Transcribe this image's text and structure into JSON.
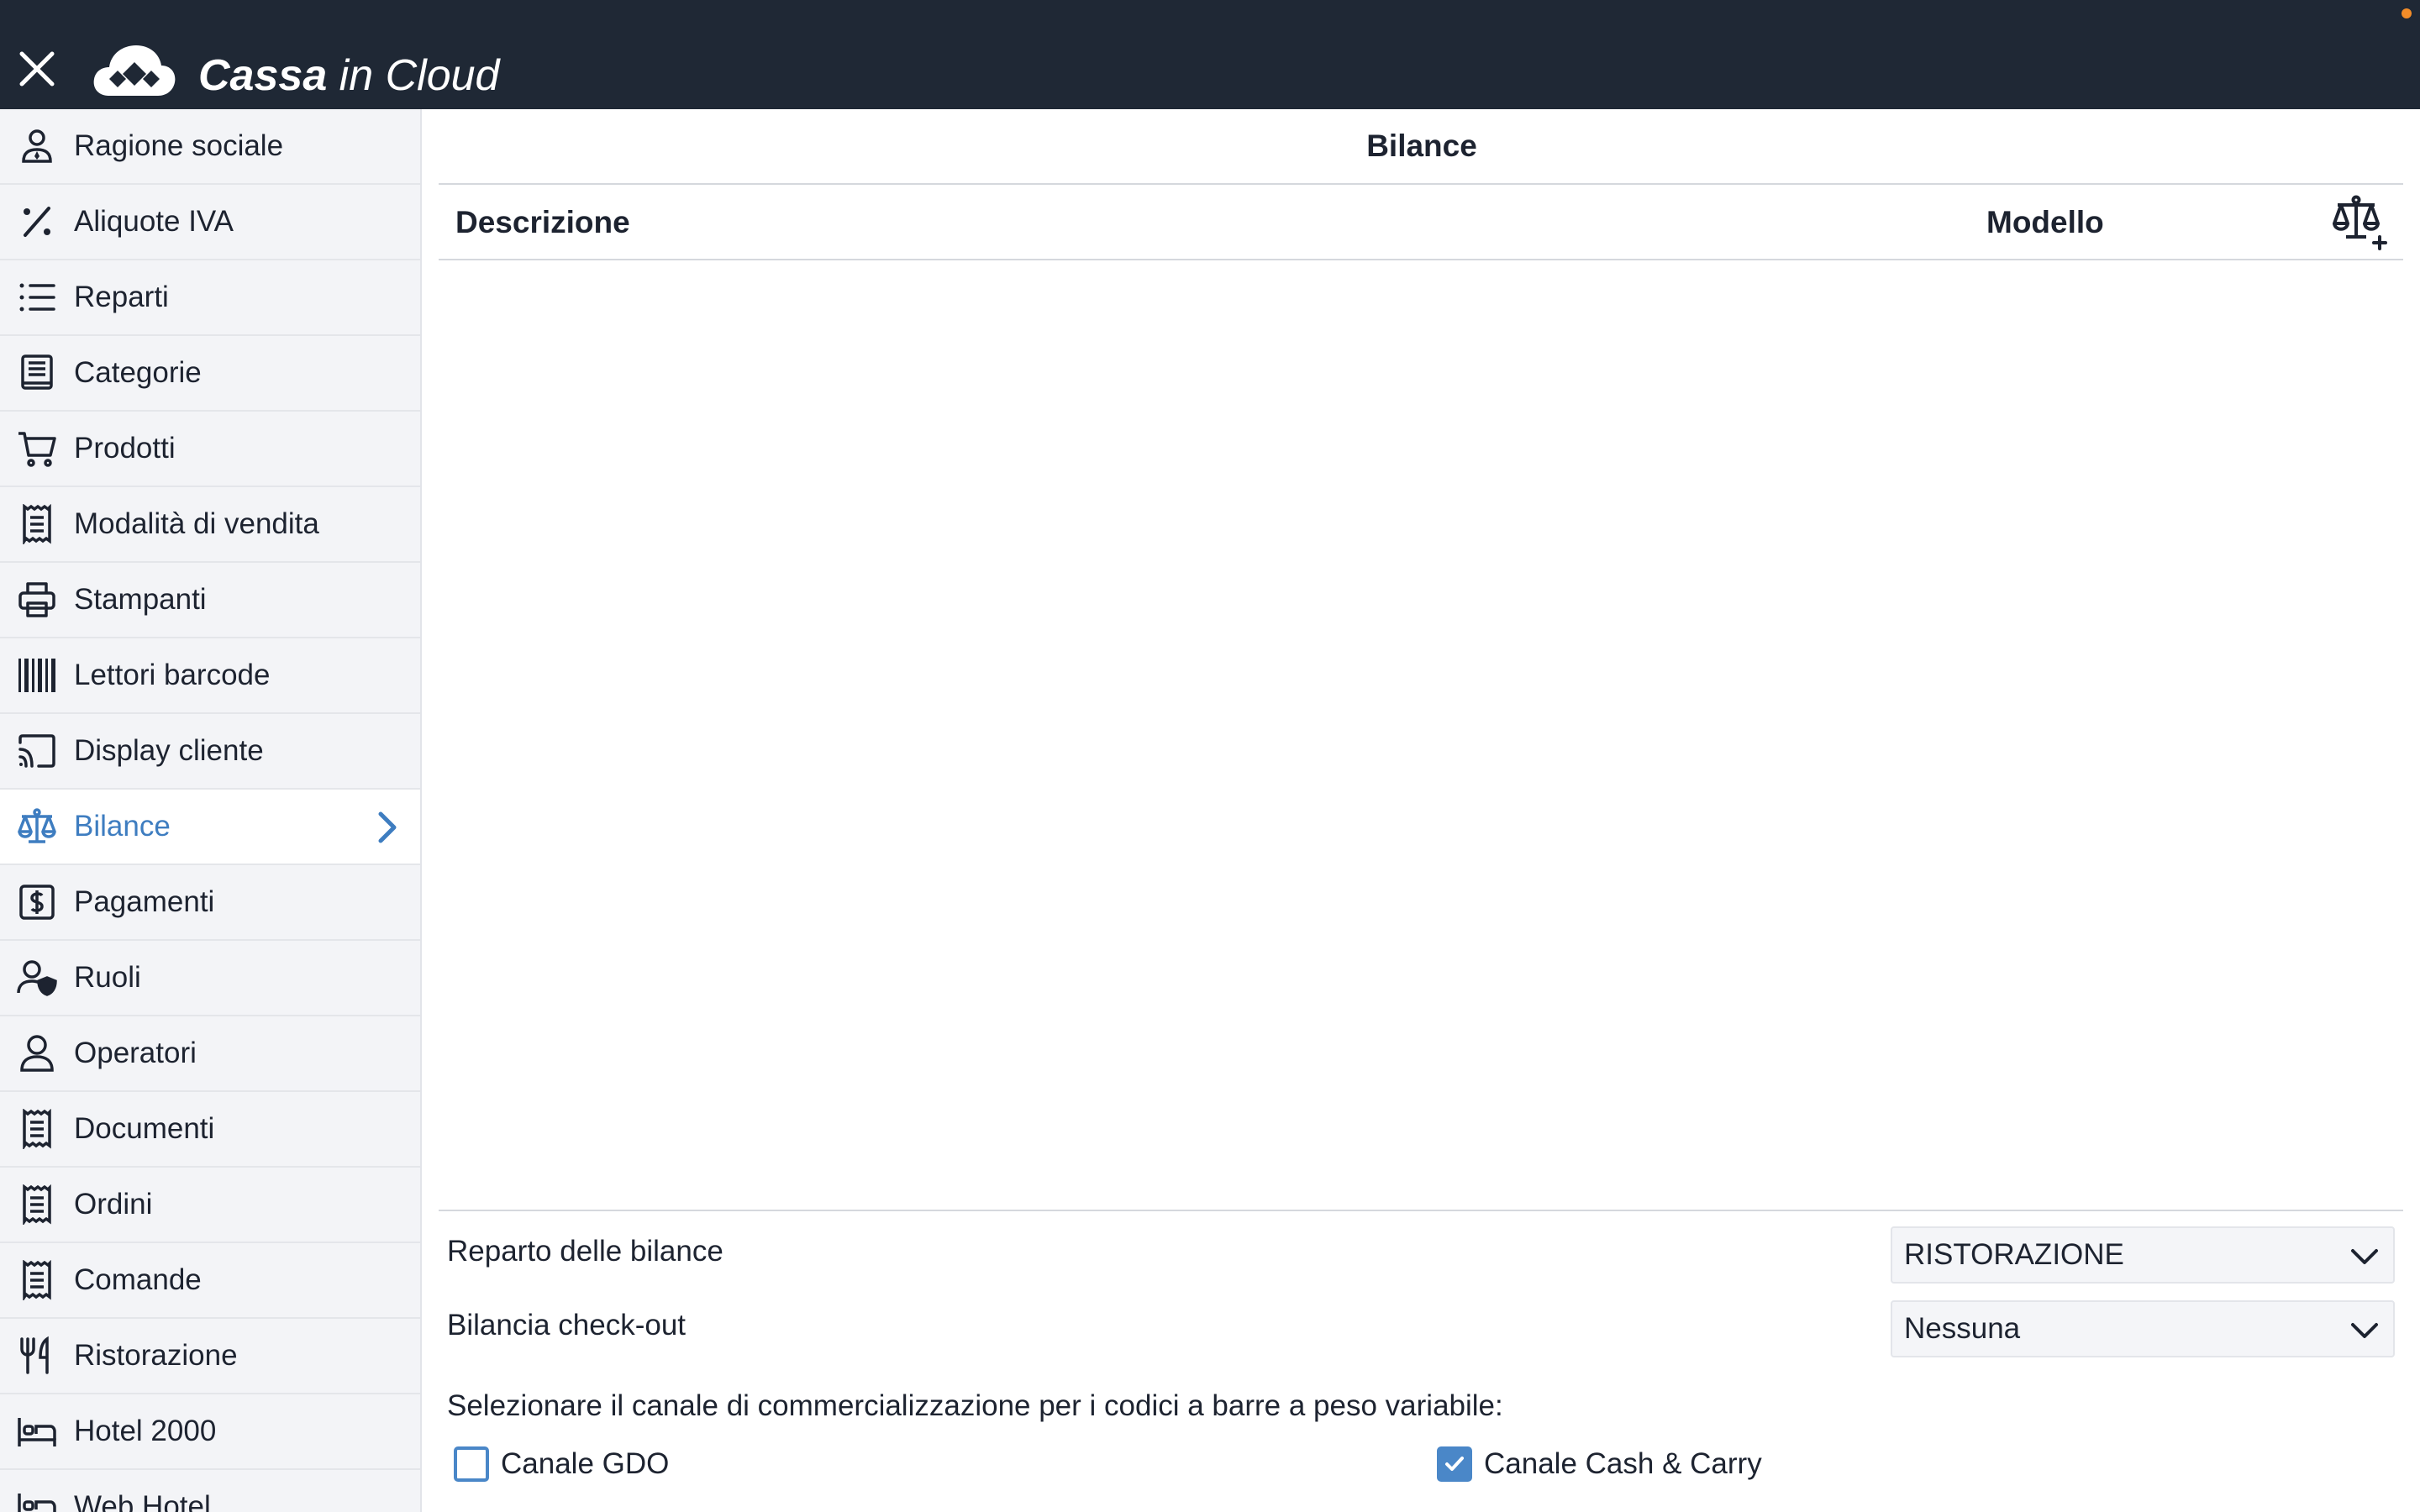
{
  "app": {
    "brand_bold": "Cassa",
    "brand_light": " in Cloud"
  },
  "sidebar": {
    "items": [
      {
        "label": "Ragione sociale",
        "icon": "company-person-icon"
      },
      {
        "label": "Aliquote IVA",
        "icon": "percent-icon"
      },
      {
        "label": "Reparti",
        "icon": "list-icon"
      },
      {
        "label": "Categorie",
        "icon": "book-icon"
      },
      {
        "label": "Prodotti",
        "icon": "cart-icon"
      },
      {
        "label": "Modalità di vendita",
        "icon": "receipt-icon"
      },
      {
        "label": "Stampanti",
        "icon": "printer-icon"
      },
      {
        "label": "Lettori barcode",
        "icon": "barcode-icon"
      },
      {
        "label": "Display cliente",
        "icon": "cast-display-icon"
      },
      {
        "label": "Bilance",
        "icon": "scale-icon",
        "active": true
      },
      {
        "label": "Pagamenti",
        "icon": "dollar-icon"
      },
      {
        "label": "Ruoli",
        "icon": "user-shield-icon"
      },
      {
        "label": "Operatori",
        "icon": "user-icon"
      },
      {
        "label": "Documenti",
        "icon": "receipt-icon"
      },
      {
        "label": "Ordini",
        "icon": "receipt-icon"
      },
      {
        "label": "Comande",
        "icon": "receipt-icon"
      },
      {
        "label": "Ristorazione",
        "icon": "fork-knife-icon"
      },
      {
        "label": "Hotel 2000",
        "icon": "bed-icon"
      },
      {
        "label": "Web Hotel",
        "icon": "bed-icon"
      }
    ]
  },
  "main": {
    "title": "Bilance",
    "columns": {
      "description": "Descrizione",
      "model": "Modello"
    },
    "settings": {
      "scale_department_label": "Reparto delle bilance",
      "scale_department_value": "RISTORAZIONE",
      "checkout_scale_label": "Bilancia check-out",
      "checkout_scale_value": "Nessuna",
      "channel_hint": "Selezionare il canale di commercializzazione per i codici a barre a peso variabile:",
      "channel_gdo": "Canale GDO",
      "channel_gdo_checked": false,
      "channel_cash_carry": "Canale Cash & Carry",
      "channel_cash_carry_checked": true
    }
  },
  "colors": {
    "topbar": "#1f2835",
    "accent": "#3e7dc0",
    "sidebar_bg": "#f3f4f7",
    "notification_dot": "#f28c28"
  }
}
